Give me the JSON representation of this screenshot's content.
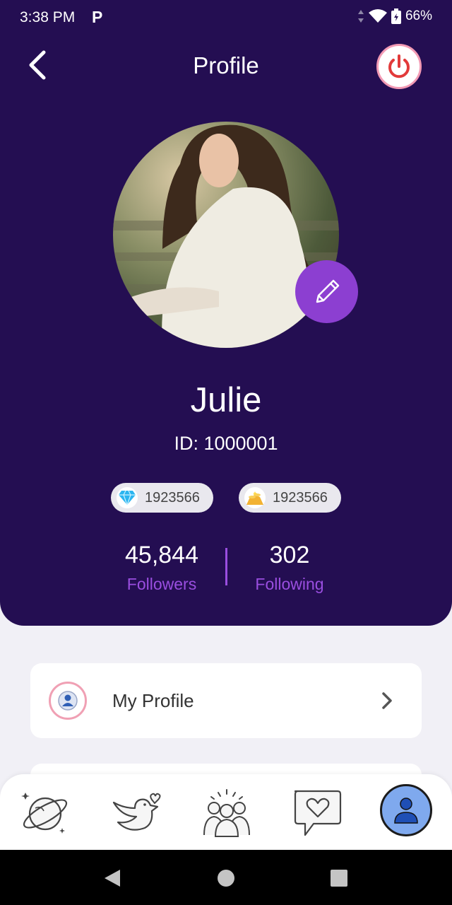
{
  "status_bar": {
    "time": "3:38 PM",
    "app_indicator": "P",
    "battery": "66%"
  },
  "header": {
    "title": "Profile"
  },
  "profile": {
    "name": "Julie",
    "id_text": "ID: 1000001",
    "gems": "1923566",
    "coins": "1923566",
    "followers_count": "45,844",
    "followers_label": "Followers",
    "following_count": "302",
    "following_label": "Following"
  },
  "menu": {
    "items": [
      {
        "label": "My Profile"
      }
    ]
  },
  "bottom_nav": {
    "items": [
      {
        "icon": "planet-icon"
      },
      {
        "icon": "bird-heart-icon"
      },
      {
        "icon": "group-icon"
      },
      {
        "icon": "chat-heart-icon"
      },
      {
        "icon": "user-icon",
        "active": true
      }
    ]
  },
  "colors": {
    "header_bg": "#240e52",
    "accent_purple": "#8c3fd1",
    "stat_label": "#9a4ee0",
    "page_bg": "#f1f0f6",
    "power_red": "#e23a3a"
  }
}
